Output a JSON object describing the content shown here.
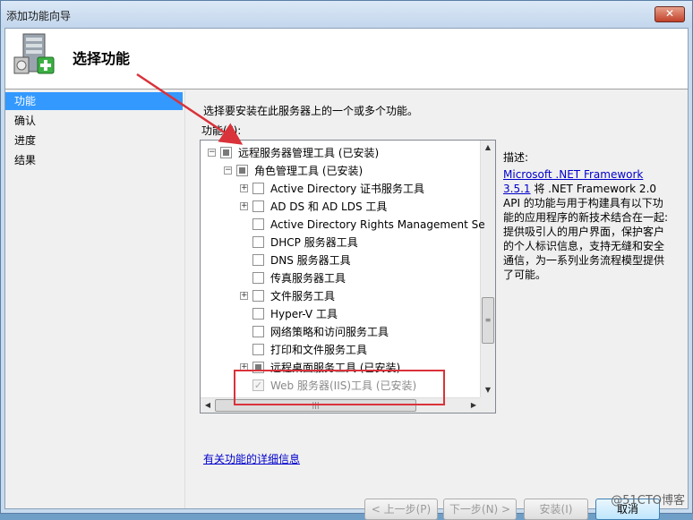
{
  "window": {
    "title": "添加功能向导",
    "close_label": "✕"
  },
  "header": {
    "title": "选择功能"
  },
  "sidebar": {
    "items": [
      {
        "label": "功能",
        "active": true
      },
      {
        "label": "确认",
        "active": false
      },
      {
        "label": "进度",
        "active": false
      },
      {
        "label": "结果",
        "active": false
      }
    ]
  },
  "main": {
    "instruction": "选择要安装在此服务器上的一个或多个功能。",
    "features_label": "功能(F):",
    "tree": [
      {
        "label": "远程服务器管理工具 (已安装)",
        "state": "partial",
        "expander": "−",
        "disabled": false
      },
      {
        "label": "角色管理工具 (已安装)",
        "state": "partial",
        "expander": "−",
        "disabled": false
      },
      {
        "label": "Active Directory 证书服务工具",
        "state": "unchecked",
        "expander": "+",
        "disabled": false
      },
      {
        "label": "AD DS 和 AD LDS 工具",
        "state": "unchecked",
        "expander": "+",
        "disabled": false
      },
      {
        "label": "Active Directory Rights Management Se",
        "state": "unchecked",
        "expander": "",
        "disabled": false
      },
      {
        "label": "DHCP 服务器工具",
        "state": "unchecked",
        "expander": "",
        "disabled": false
      },
      {
        "label": "DNS 服务器工具",
        "state": "unchecked",
        "expander": "",
        "disabled": false
      },
      {
        "label": "传真服务器工具",
        "state": "unchecked",
        "expander": "",
        "disabled": false
      },
      {
        "label": "文件服务工具",
        "state": "unchecked",
        "expander": "+",
        "disabled": false
      },
      {
        "label": "Hyper-V 工具",
        "state": "unchecked",
        "expander": "",
        "disabled": false
      },
      {
        "label": "网络策略和访问服务工具",
        "state": "unchecked",
        "expander": "",
        "disabled": false
      },
      {
        "label": "打印和文件服务工具",
        "state": "unchecked",
        "expander": "",
        "disabled": false
      },
      {
        "label": "远程桌面服务工具 (已安装)",
        "state": "partial",
        "expander": "+",
        "disabled": false
      },
      {
        "label": "Web 服务器(IIS)工具 (已安装)",
        "state": "checked",
        "expander": "",
        "disabled": true
      }
    ],
    "description": {
      "label": "描述:",
      "link": "Microsoft .NET Framework 3.5.1",
      "text": " 将 .NET Framework 2.0 API 的功能与用于构建具有以下功能的应用程序的新技术结合在一起: 提供吸引人的用户界面，保护客户的个人标识信息，支持无缝和安全通信，为一系列业务流程模型提供了可能。"
    },
    "more_info_link": "有关功能的详细信息"
  },
  "buttons": {
    "prev": "< 上一步(P)",
    "next": "下一步(N) >",
    "install": "安装(I)",
    "cancel": "取消"
  },
  "watermark": "@51CTO博客",
  "colors": {
    "accent": "#3399ff",
    "highlight": "#d9323a"
  }
}
